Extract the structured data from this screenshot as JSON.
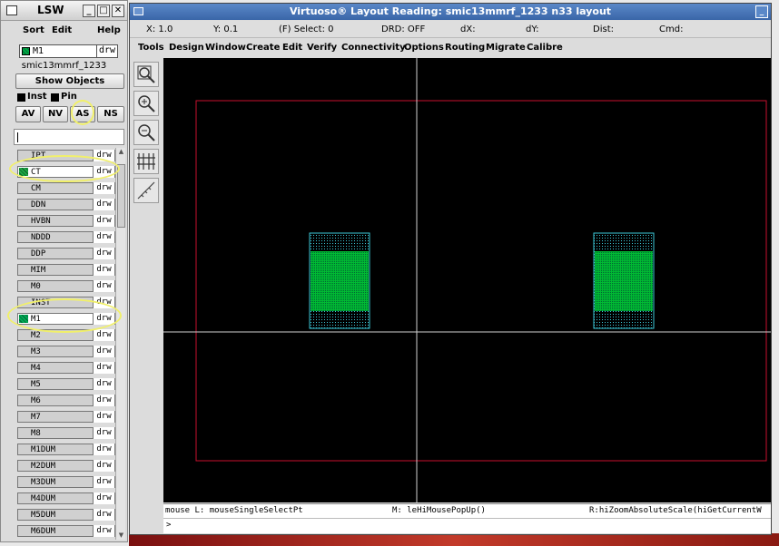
{
  "lsw": {
    "title": "LSW",
    "menus": [
      "Sort",
      "Edit",
      "Help"
    ],
    "current_layer": {
      "name": "M1",
      "purpose": "drw"
    },
    "library": "smic13mmrf_1233",
    "show_objects_label": "Show Objects",
    "inst_label": "Inst",
    "pin_label": "Pin",
    "mode_buttons": [
      "AV",
      "NV",
      "AS",
      "NS"
    ],
    "layers": [
      {
        "name": "IPT",
        "purpose": "drw",
        "color": "#d0d0d0"
      },
      {
        "name": "CT",
        "purpose": "drw",
        "color": "#1fa845"
      },
      {
        "name": "CM",
        "purpose": "drw",
        "color": "#d0d0d0"
      },
      {
        "name": "DDN",
        "purpose": "drw",
        "color": "#d0d0d0"
      },
      {
        "name": "HVBN",
        "purpose": "drw",
        "color": "#d0d0d0"
      },
      {
        "name": "NDDD",
        "purpose": "drw",
        "color": "#d0d0d0"
      },
      {
        "name": "DDP",
        "purpose": "drw",
        "color": "#d0d0d0"
      },
      {
        "name": "MIM",
        "purpose": "drw",
        "color": "#d0d0d0"
      },
      {
        "name": "M0",
        "purpose": "drw",
        "color": "#d0d0d0"
      },
      {
        "name": "INST",
        "purpose": "drw",
        "color": "#d0d0d0"
      },
      {
        "name": "M1",
        "purpose": "drw",
        "color": "#0a5"
      },
      {
        "name": "M2",
        "purpose": "drw",
        "color": "#d0d0d0"
      },
      {
        "name": "M3",
        "purpose": "drw",
        "color": "#d0d0d0"
      },
      {
        "name": "M4",
        "purpose": "drw",
        "color": "#d0d0d0"
      },
      {
        "name": "M5",
        "purpose": "drw",
        "color": "#d0d0d0"
      },
      {
        "name": "M6",
        "purpose": "drw",
        "color": "#d0d0d0"
      },
      {
        "name": "M7",
        "purpose": "drw",
        "color": "#d0d0d0"
      },
      {
        "name": "M8",
        "purpose": "drw",
        "color": "#d0d0d0"
      },
      {
        "name": "M1DUM",
        "purpose": "drw",
        "color": "#d0d0d0"
      },
      {
        "name": "M2DUM",
        "purpose": "drw",
        "color": "#d0d0d0"
      },
      {
        "name": "M3DUM",
        "purpose": "drw",
        "color": "#d0d0d0"
      },
      {
        "name": "M4DUM",
        "purpose": "drw",
        "color": "#d0d0d0"
      },
      {
        "name": "M5DUM",
        "purpose": "drw",
        "color": "#d0d0d0"
      },
      {
        "name": "M6DUM",
        "purpose": "drw",
        "color": "#d0d0d0"
      }
    ]
  },
  "virtuoso": {
    "title": "Virtuoso® Layout Reading: smic13mmrf_1233 n33 layout",
    "status": {
      "x": "X: 1.0",
      "y": "Y: 0.1",
      "select": "(F) Select: 0",
      "drd": "DRD: OFF",
      "dx": "dX:",
      "dy": "dY:",
      "dist": "Dist:",
      "cmd": "Cmd:"
    },
    "menus": [
      "Tools",
      "Design",
      "Window",
      "Create",
      "Edit",
      "Verify",
      "Connectivity",
      "Options",
      "Routing",
      "Migrate",
      "Calibre"
    ],
    "tools": [
      "zoom-fit-icon",
      "zoom-in-icon",
      "zoom-out-icon",
      "stretch-icon",
      "ruler-icon"
    ],
    "mouse_left": "mouse L: mouseSingleSelectPt",
    "mouse_mid": "M: leHiMousePopUp()",
    "mouse_right": "R:hiZoomAbsoluteScale(hiGetCurrentW",
    "prompt": ">"
  },
  "colors": {
    "annotation": "#f1f06a",
    "boundary": "#c8102e",
    "cut_layer": "#1fa845",
    "metal1_outline": "#3cc8d8"
  }
}
